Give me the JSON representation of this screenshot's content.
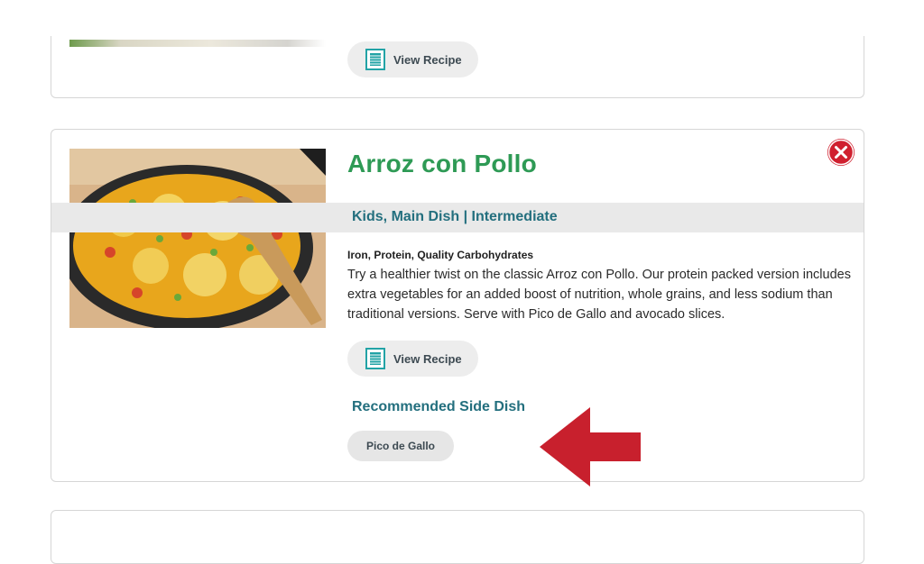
{
  "previous_card": {
    "view_recipe_label": "View Recipe"
  },
  "recipe": {
    "title": "Arroz con Pollo",
    "categories": "Kids, Main Dish | Intermediate",
    "nutrients": "Iron, Protein, Quality Carbohydrates",
    "description": "Try a healthier twist on the classic Arroz con Pollo. Our protein packed version includes extra vegetables for an added boost of nutrition, whole grains, and less sodium than traditional versions. Serve with Pico de Gallo and avocado slices.",
    "view_recipe_label": "View Recipe",
    "side_dish_heading": "Recommended Side Dish",
    "side_dish": "Pico de Gallo"
  },
  "icons": {
    "recipe_button": "document-icon",
    "close": "close-icon",
    "annotation": "arrow-left-icon"
  },
  "colors": {
    "title_green": "#2e9a55",
    "heading_teal": "#236f7e",
    "close_red": "#d0202f",
    "arrow_red": "#c8202d",
    "icon_teal": "#22a3a6"
  }
}
